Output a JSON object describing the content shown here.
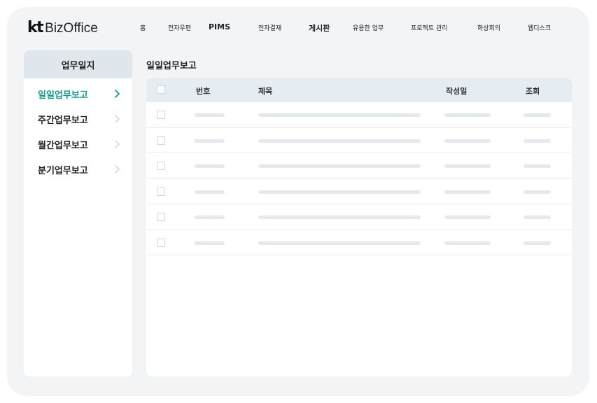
{
  "header": {
    "logo_mark": "kt",
    "logo_name": "BizOffice",
    "nav": [
      {
        "label": "홈"
      },
      {
        "label": "전자우편"
      },
      {
        "label": "PIMS"
      },
      {
        "label": "전자결재"
      },
      {
        "label": "게시판"
      },
      {
        "label": "유용한 업무"
      },
      {
        "label": "프로젝트 관리"
      },
      {
        "label": "화상회의"
      },
      {
        "label": "웹디스크"
      }
    ]
  },
  "sidebar": {
    "title": "업무일지",
    "items": [
      {
        "label": "일일업무보고",
        "active": true
      },
      {
        "label": "주간업무보고",
        "active": false
      },
      {
        "label": "월간업무보고",
        "active": false
      },
      {
        "label": "분기업무보고",
        "active": false
      }
    ]
  },
  "main": {
    "title": "일일업무보고",
    "table": {
      "columns": [
        "번호",
        "제목",
        "작성일",
        "조회"
      ]
    }
  },
  "colors": {
    "accent": "#0f9b8e",
    "background": "#f2f4f6",
    "header_row": "#e6edf2",
    "placeholder_bar": "#e6eaed"
  }
}
